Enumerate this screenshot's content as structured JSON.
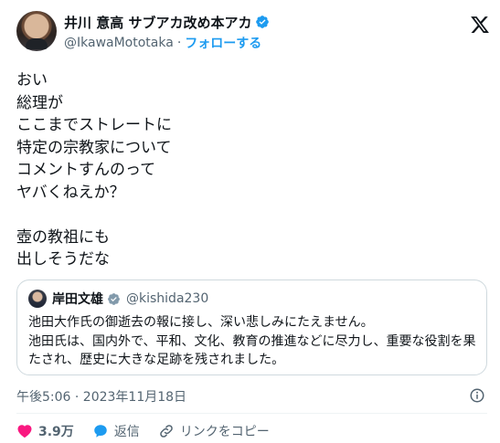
{
  "author": {
    "display_name": "井川 意高 サブアカ改め本アカ",
    "handle": "@IkawaMototaka",
    "separator": "·",
    "follow_label": "フォローする"
  },
  "tweet": {
    "text": "おい\n総理が\nここまでストレートに\n特定の宗教家について\nコメントすんのって\nヤバくねえか？\n\n壺の教祖にも\n出しそうだな"
  },
  "quote": {
    "display_name": "岸田文雄",
    "handle": "@kishida230",
    "text": "池田大作氏の御逝去の報に接し、深い悲しみにたえません。\n池田氏は、国内外で、平和、文化、教育の推進などに尽力し、重要な役割を果たされ、歴史に大きな足跡を残されました。"
  },
  "meta": {
    "timestamp": "午後5:06 · 2023年11月18日"
  },
  "actions": {
    "like_count": "3.9万",
    "reply_label": "返信",
    "copy_link_label": "リンクをコピー"
  },
  "colors": {
    "accent": "#1d9bf0",
    "like": "#f91880",
    "text": "#0f1419",
    "secondary": "#536471",
    "border": "#cfd9de"
  },
  "icons": {
    "verified": "verified-badge-icon",
    "platform": "x-logo-icon",
    "info": "info-icon",
    "like": "heart-icon",
    "reply": "speech-bubble-icon",
    "copy": "link-icon"
  }
}
